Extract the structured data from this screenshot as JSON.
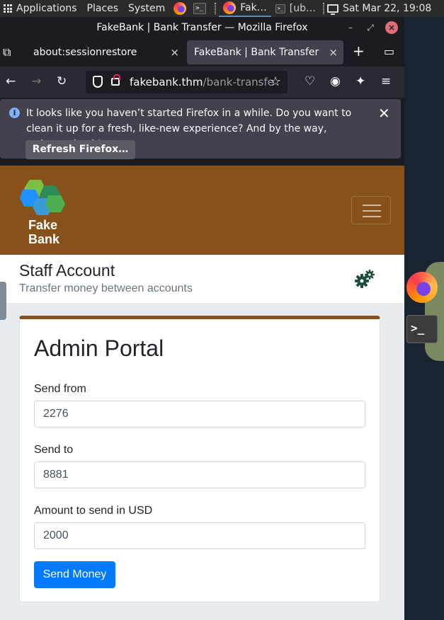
{
  "panel": {
    "applications": "Applications",
    "places": "Places",
    "system": "System",
    "task_firefox": "Fak…",
    "task_terminal": "[ub…",
    "clock": "Sat Mar 22, 19:08"
  },
  "window": {
    "title": "FakeBank | Bank Transfer — Mozilla Firefox"
  },
  "tabs": [
    {
      "label": "about:sessionrestore"
    },
    {
      "label": "FakeBank | Bank Transfer"
    }
  ],
  "urlbar": {
    "host": "fakebank.thm",
    "path": "/bank-transfe"
  },
  "notice": {
    "text": "It looks like you haven’t started Firefox in a while. Do you want to clean it up for a fresh, like-new experience? And by the way, welcome back!",
    "button": "Refresh Firefox…"
  },
  "site": {
    "logo_line1": "Fake",
    "logo_line2": "Bank",
    "staff_title": "Staff Account",
    "staff_subtitle": "Transfer money between accounts"
  },
  "form": {
    "title": "Admin Portal",
    "send_from_label": "Send from",
    "send_from_value": "2276",
    "send_to_label": "Send to",
    "send_to_value": "8881",
    "amount_label": "Amount to send in USD",
    "amount_value": "2000",
    "submit": "Send Money"
  },
  "colors": {
    "brand": "#87511b",
    "primary": "#007bff",
    "gear": "#1e4d3a"
  }
}
